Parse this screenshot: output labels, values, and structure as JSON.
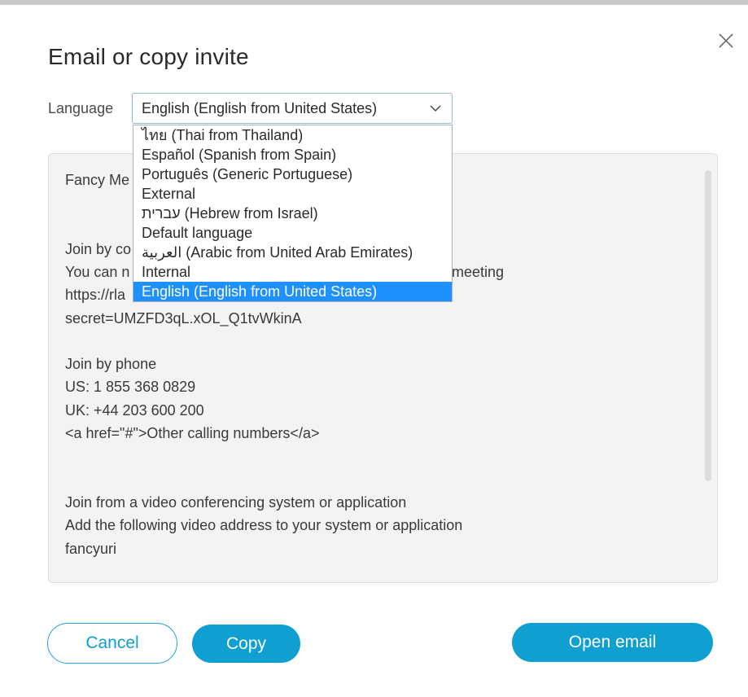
{
  "dialog": {
    "title": "Email or copy invite",
    "close_icon": "close-icon"
  },
  "language": {
    "label": "Language",
    "selected": "English (English from United States)",
    "chevron_icon": "chevron-down-icon",
    "options": [
      "ไทย (Thai from Thailand)",
      "Español (Spanish from Spain)",
      "Português (Generic Portuguese)",
      "External",
      "עברית (Hebrew from Israel)",
      "Default language",
      "العربية (Arabic from United Arab Emirates)",
      "Internal",
      "English (English from United States)"
    ],
    "highlighted_index": 8
  },
  "message": {
    "lines": [
      "Fancy Me",
      "Join by co",
      "You can n",
      "meeting",
      "https://rla",
      "secret=UMZFD3qL.xOL_Q1tvWkinA",
      "Join by phone",
      "US: 1 855 368 0829",
      "UK: +44 203 600 200",
      "<a href=\"#\">Other calling numbers</a>",
      "Join from a video conferencing system or application",
      "Add the following video address to your system or application",
      "fancyuri"
    ]
  },
  "buttons": {
    "cancel": "Cancel",
    "copy": "Copy",
    "open_email": "Open email"
  },
  "colors": {
    "accent": "#0f9fd0",
    "highlight": "#1e90ff"
  }
}
